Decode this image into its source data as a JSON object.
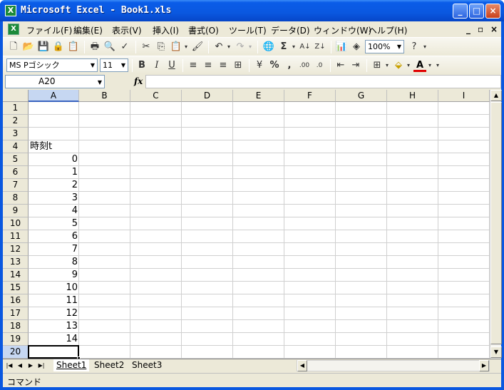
{
  "window": {
    "title": "Microsoft Excel - Book1.xls",
    "app_icon": "excel-icon",
    "controls": {
      "minimize": "_",
      "maximize": "□",
      "close": "×"
    }
  },
  "menu": {
    "items": [
      {
        "label": "ファイル(F)"
      },
      {
        "label": "編集(E)"
      },
      {
        "label": "表示(V)"
      },
      {
        "label": "挿入(I)"
      },
      {
        "label": "書式(O)"
      },
      {
        "label": "ツール(T)"
      },
      {
        "label": "データ(D)"
      },
      {
        "label": "ウィンドウ(W)"
      },
      {
        "label": "ヘルプ(H)"
      }
    ],
    "doc_controls": {
      "minimize": "_",
      "restore": "▫",
      "close": "×"
    }
  },
  "standard_toolbar": {
    "zoom": "100%",
    "icons": [
      "new-icon",
      "open-icon",
      "save-icon",
      "permission-icon",
      "research-icon",
      "print-icon",
      "print-preview-icon",
      "spelling-icon",
      "cut-icon",
      "copy-icon",
      "paste-icon",
      "format-painter-icon",
      "undo-icon",
      "redo-icon",
      "hyperlink-icon",
      "autosum-icon",
      "sort-ascending-icon",
      "sort-descending-icon",
      "chart-wizard-icon",
      "drawing-icon",
      "help-icon"
    ]
  },
  "formatting_toolbar": {
    "font_name": "MS Pゴシック",
    "font_size": "11",
    "bold": "B",
    "italic": "I",
    "underline": "U"
  },
  "formula_bar": {
    "name_box": "A20",
    "fx_label": "fx",
    "formula": ""
  },
  "sheet": {
    "columns": [
      "A",
      "B",
      "C",
      "D",
      "E",
      "F",
      "G",
      "H",
      "I"
    ],
    "rows": [
      "1",
      "2",
      "3",
      "4",
      "5",
      "6",
      "7",
      "8",
      "9",
      "10",
      "11",
      "12",
      "13",
      "14",
      "15",
      "16",
      "17",
      "18",
      "19",
      "20"
    ],
    "selected_column": "A",
    "selected_row": "20",
    "cells": {
      "A4": "時刻t",
      "A5": "0",
      "A6": "1",
      "A7": "2",
      "A8": "3",
      "A9": "4",
      "A10": "5",
      "A11": "6",
      "A12": "7",
      "A13": "8",
      "A14": "9",
      "A15": "10",
      "A16": "11",
      "A17": "12",
      "A18": "13",
      "A19": "14"
    }
  },
  "sheet_tabs": [
    "Sheet1",
    "Sheet2",
    "Sheet3"
  ],
  "active_sheet": "Sheet1",
  "status": {
    "mode": "コマンド"
  },
  "colors": {
    "title_bar": "#0a58e0",
    "chrome": "#ece9d8",
    "selection_header": "#c6d7f2"
  }
}
